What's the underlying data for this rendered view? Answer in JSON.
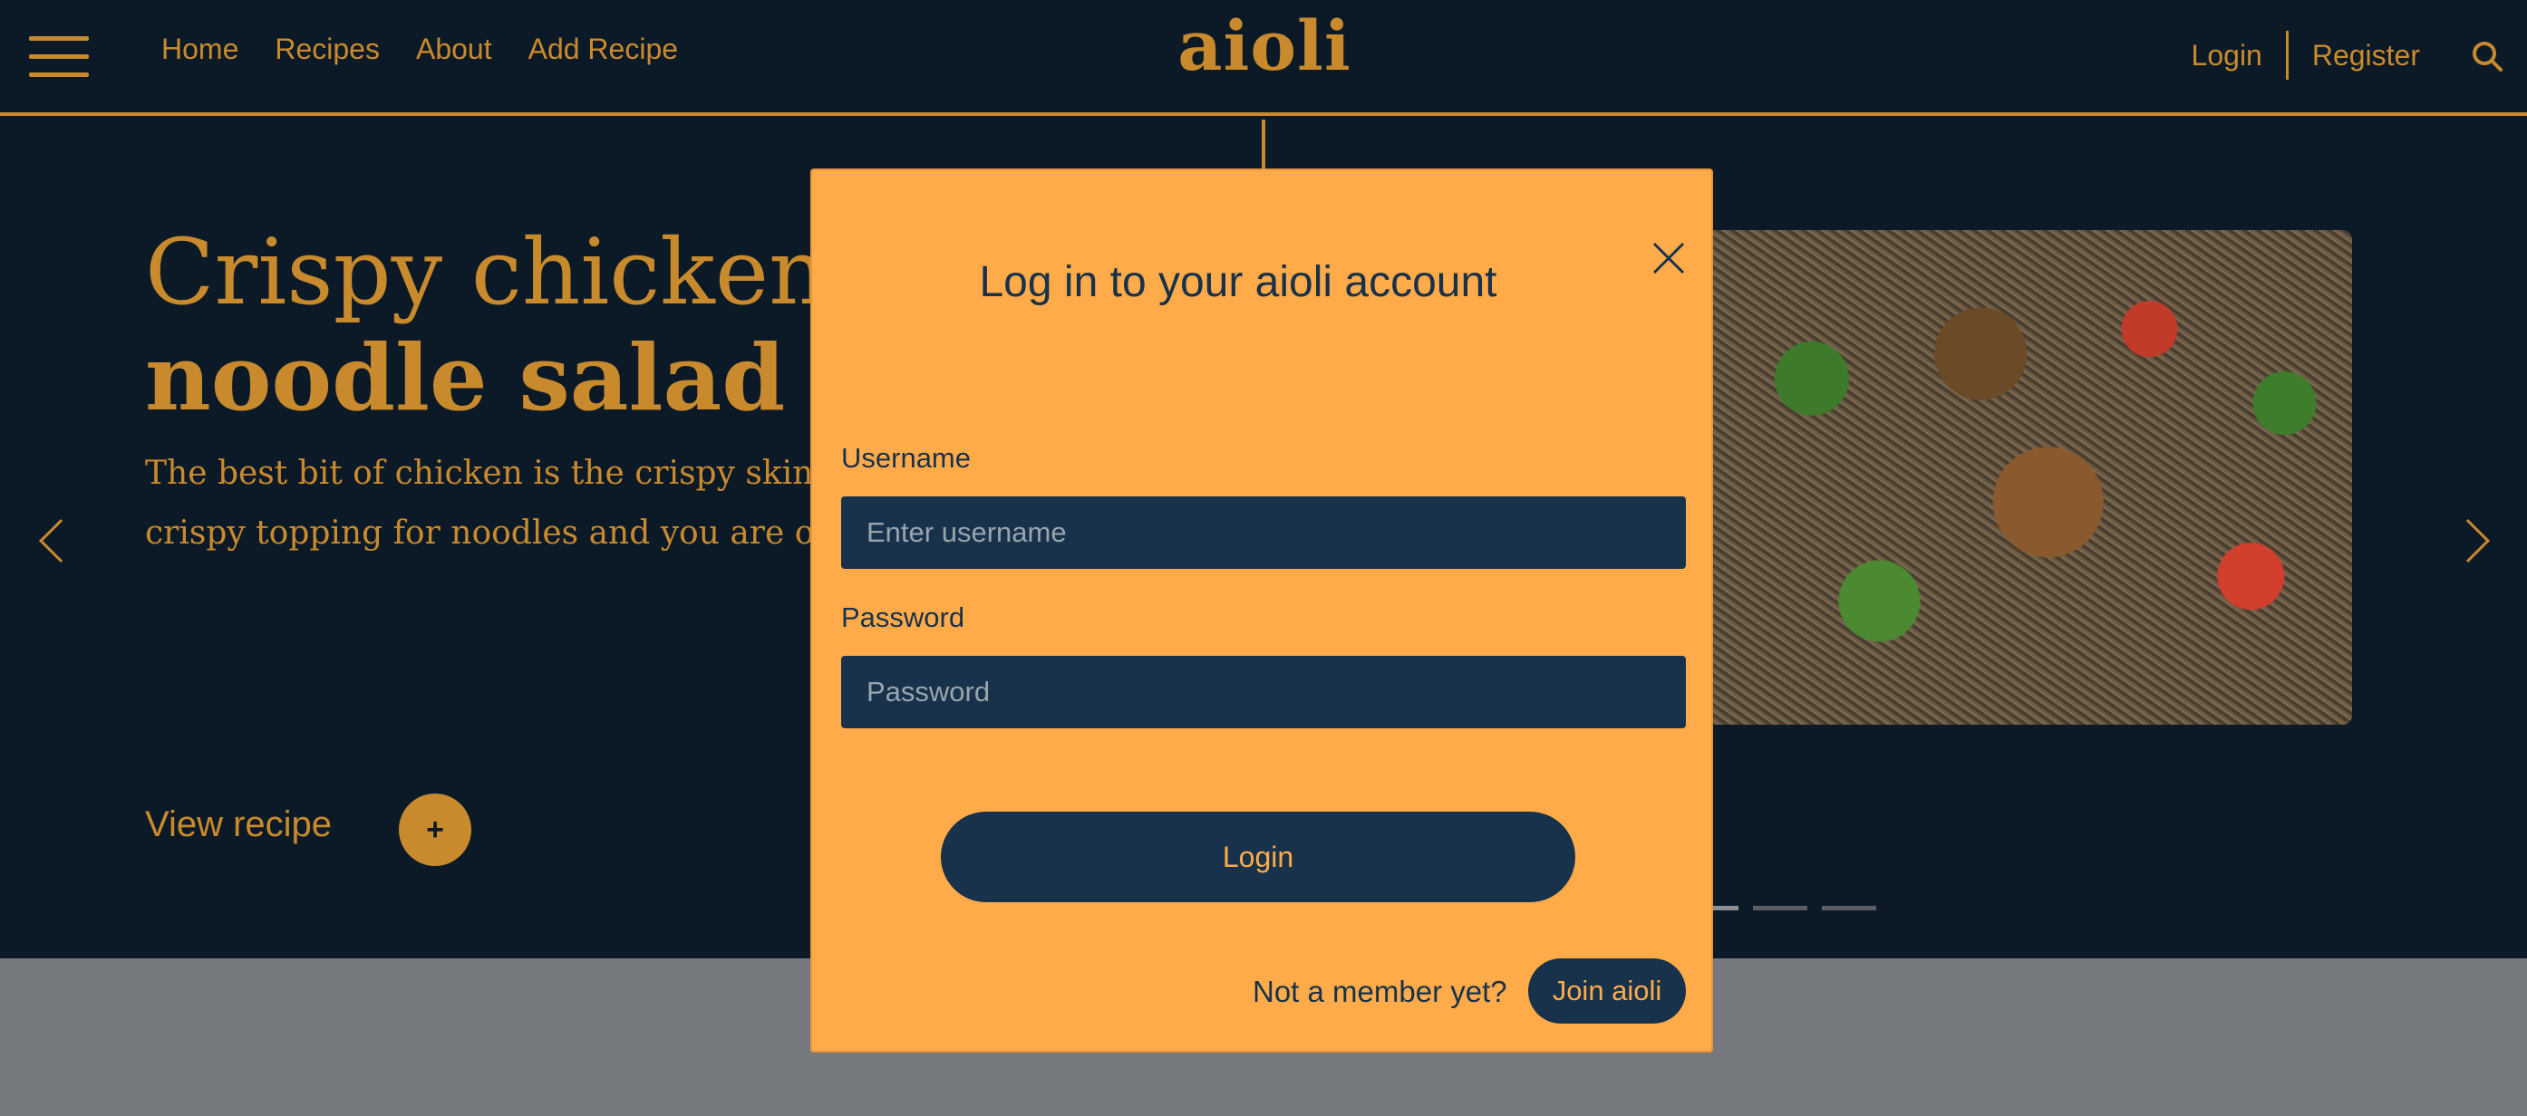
{
  "nav": {
    "links": [
      "Home",
      "Recipes",
      "About",
      "Add Recipe"
    ],
    "logo": "aioli",
    "login": "Login",
    "register": "Register"
  },
  "hero": {
    "title_line1": "Crispy chicken th",
    "title_line2": "noodle salad",
    "description_line1": "The best bit of chicken is the crispy skin",
    "description_line2": "crispy topping for noodles and you are onto",
    "view_recipe": "View recipe",
    "plus": "+"
  },
  "modal": {
    "title": "Log in to your aioli account",
    "username_label": "Username",
    "username_placeholder": "Enter username",
    "password_label": "Password",
    "password_placeholder": "Password",
    "login_button": "Login",
    "member_text": "Not a member yet?",
    "join_button": "Join aioli"
  },
  "carousel": {
    "slide_count": 3,
    "active_index": 0
  },
  "colors": {
    "background": "#0b1a26",
    "accent": "#c98a2e",
    "modal_bg": "#ffab4a",
    "modal_dark": "#17324a"
  }
}
